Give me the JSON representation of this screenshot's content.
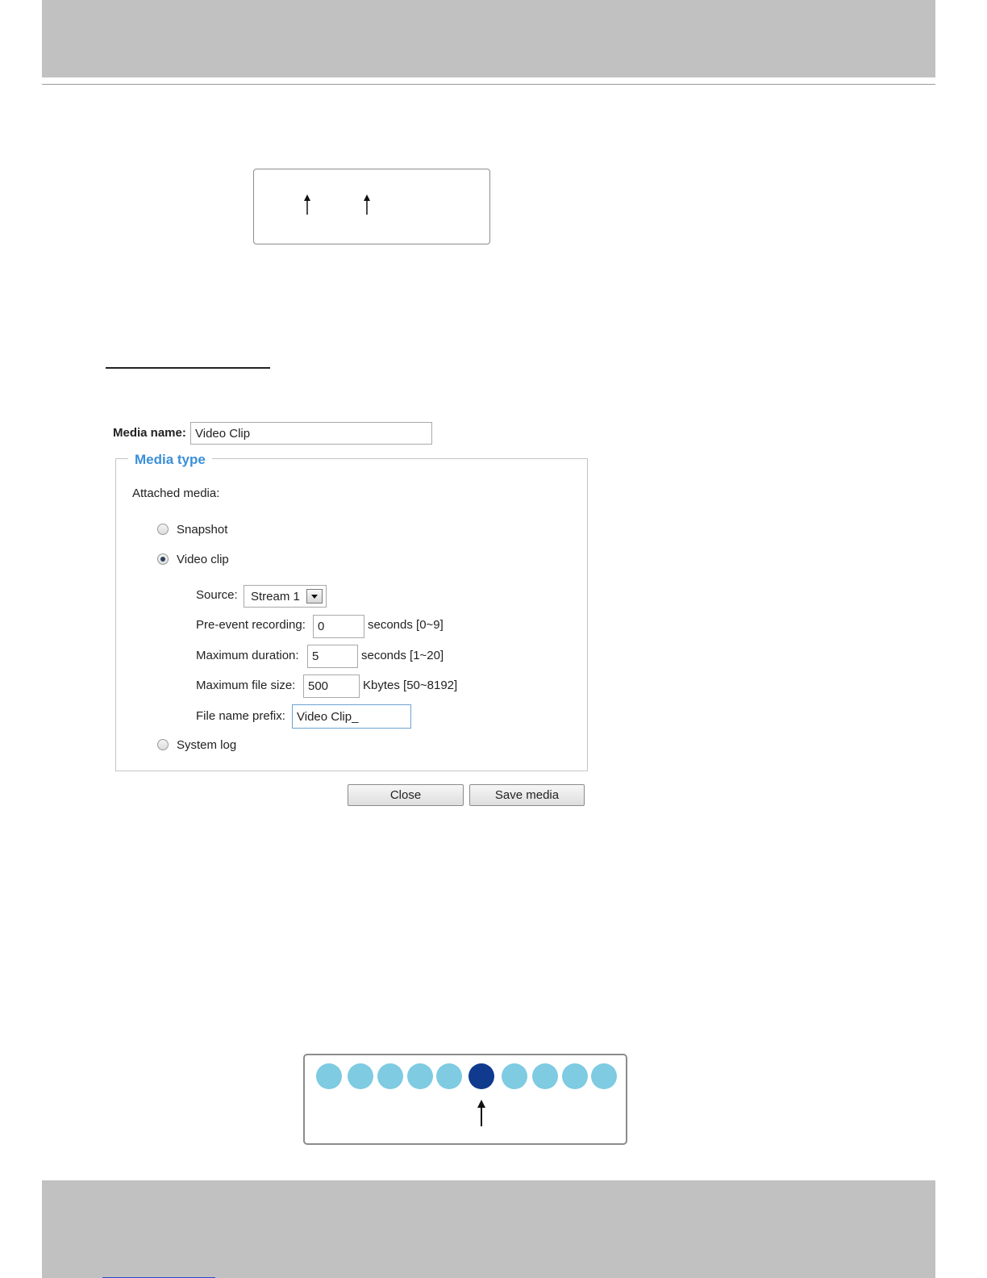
{
  "form": {
    "media_name_label": "Media name:",
    "media_name_value": "Video Clip",
    "media_type_legend": "Media type",
    "attached_media_label": "Attached media:",
    "options": {
      "snapshot": "Snapshot",
      "video_clip": "Video clip",
      "system_log": "System log"
    },
    "selected_option": "Video clip",
    "source_label": "Source:",
    "source_value": "Stream 1",
    "pre_event_label": "Pre-event recording:",
    "pre_event_value": "0",
    "pre_event_unit": "seconds [0~9]",
    "max_duration_label": "Maximum duration:",
    "max_duration_value": "5",
    "max_duration_unit": "seconds [1~20]",
    "max_file_size_label": "Maximum file size:",
    "max_file_size_value": "500",
    "max_file_size_unit": "Kbytes [50~8192]",
    "file_prefix_label": "File name prefix:",
    "file_prefix_value": "Video Clip_",
    "close_button": "Close",
    "save_button": "Save media"
  },
  "dots": {
    "count": 10,
    "highlighted_index": 5,
    "colors": {
      "normal": "#7ecbe2",
      "highlighted": "#0f3a8e"
    }
  },
  "colors": {
    "band": "#c1c1c1",
    "legend_blue": "#3b8fd8"
  }
}
